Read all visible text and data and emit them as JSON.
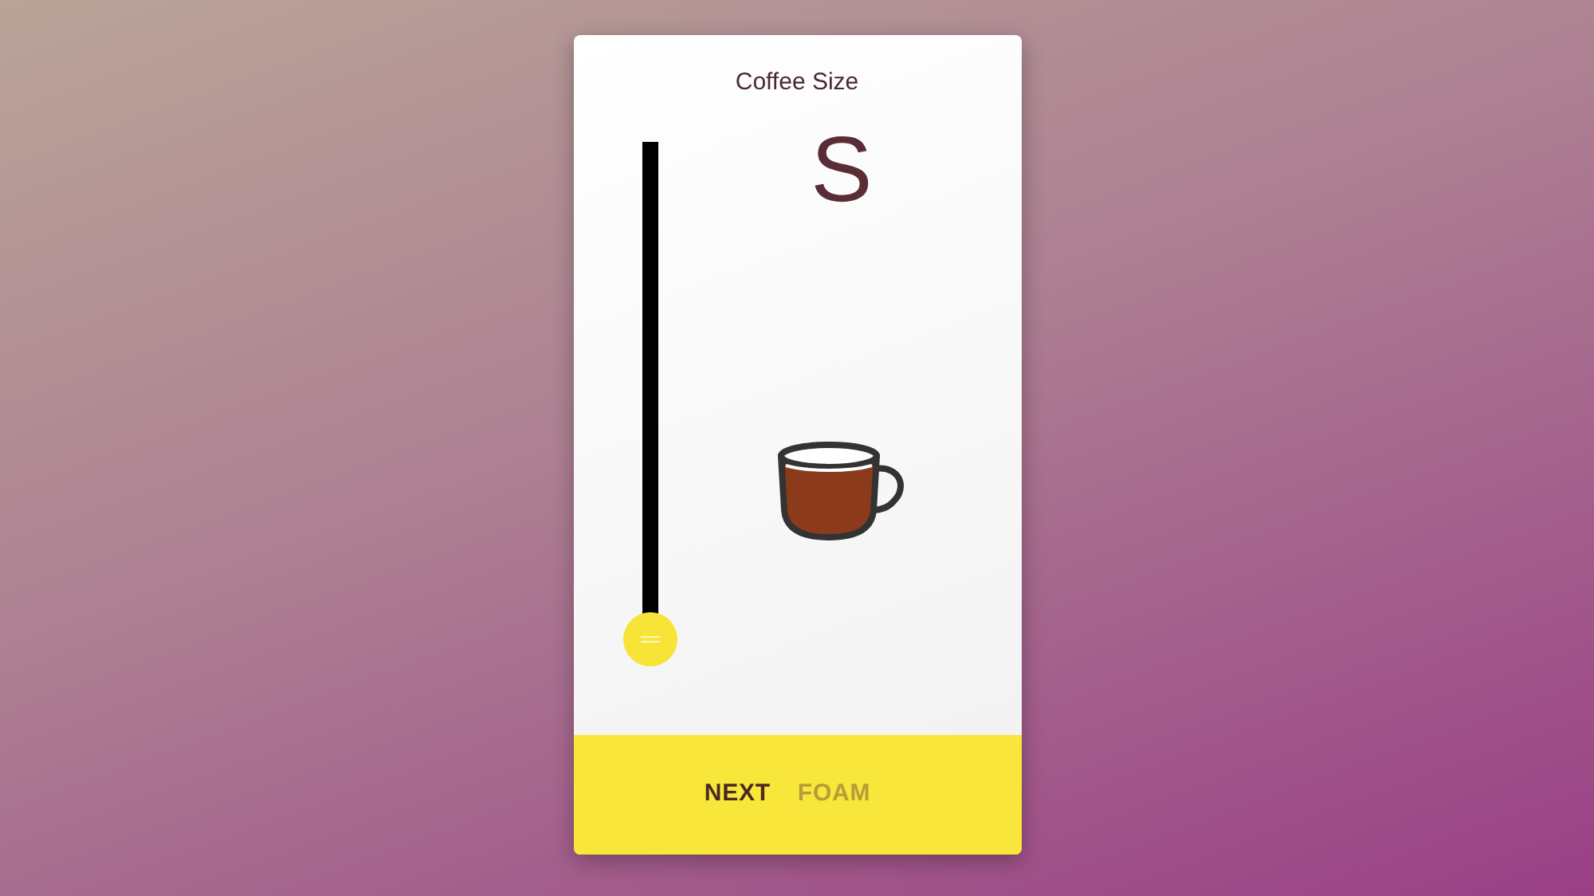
{
  "card": {
    "title": "Coffee Size"
  },
  "size_slider": {
    "level": 0
  },
  "size_label": "S",
  "footer": {
    "action": "NEXT",
    "next_step": "FOAM"
  }
}
